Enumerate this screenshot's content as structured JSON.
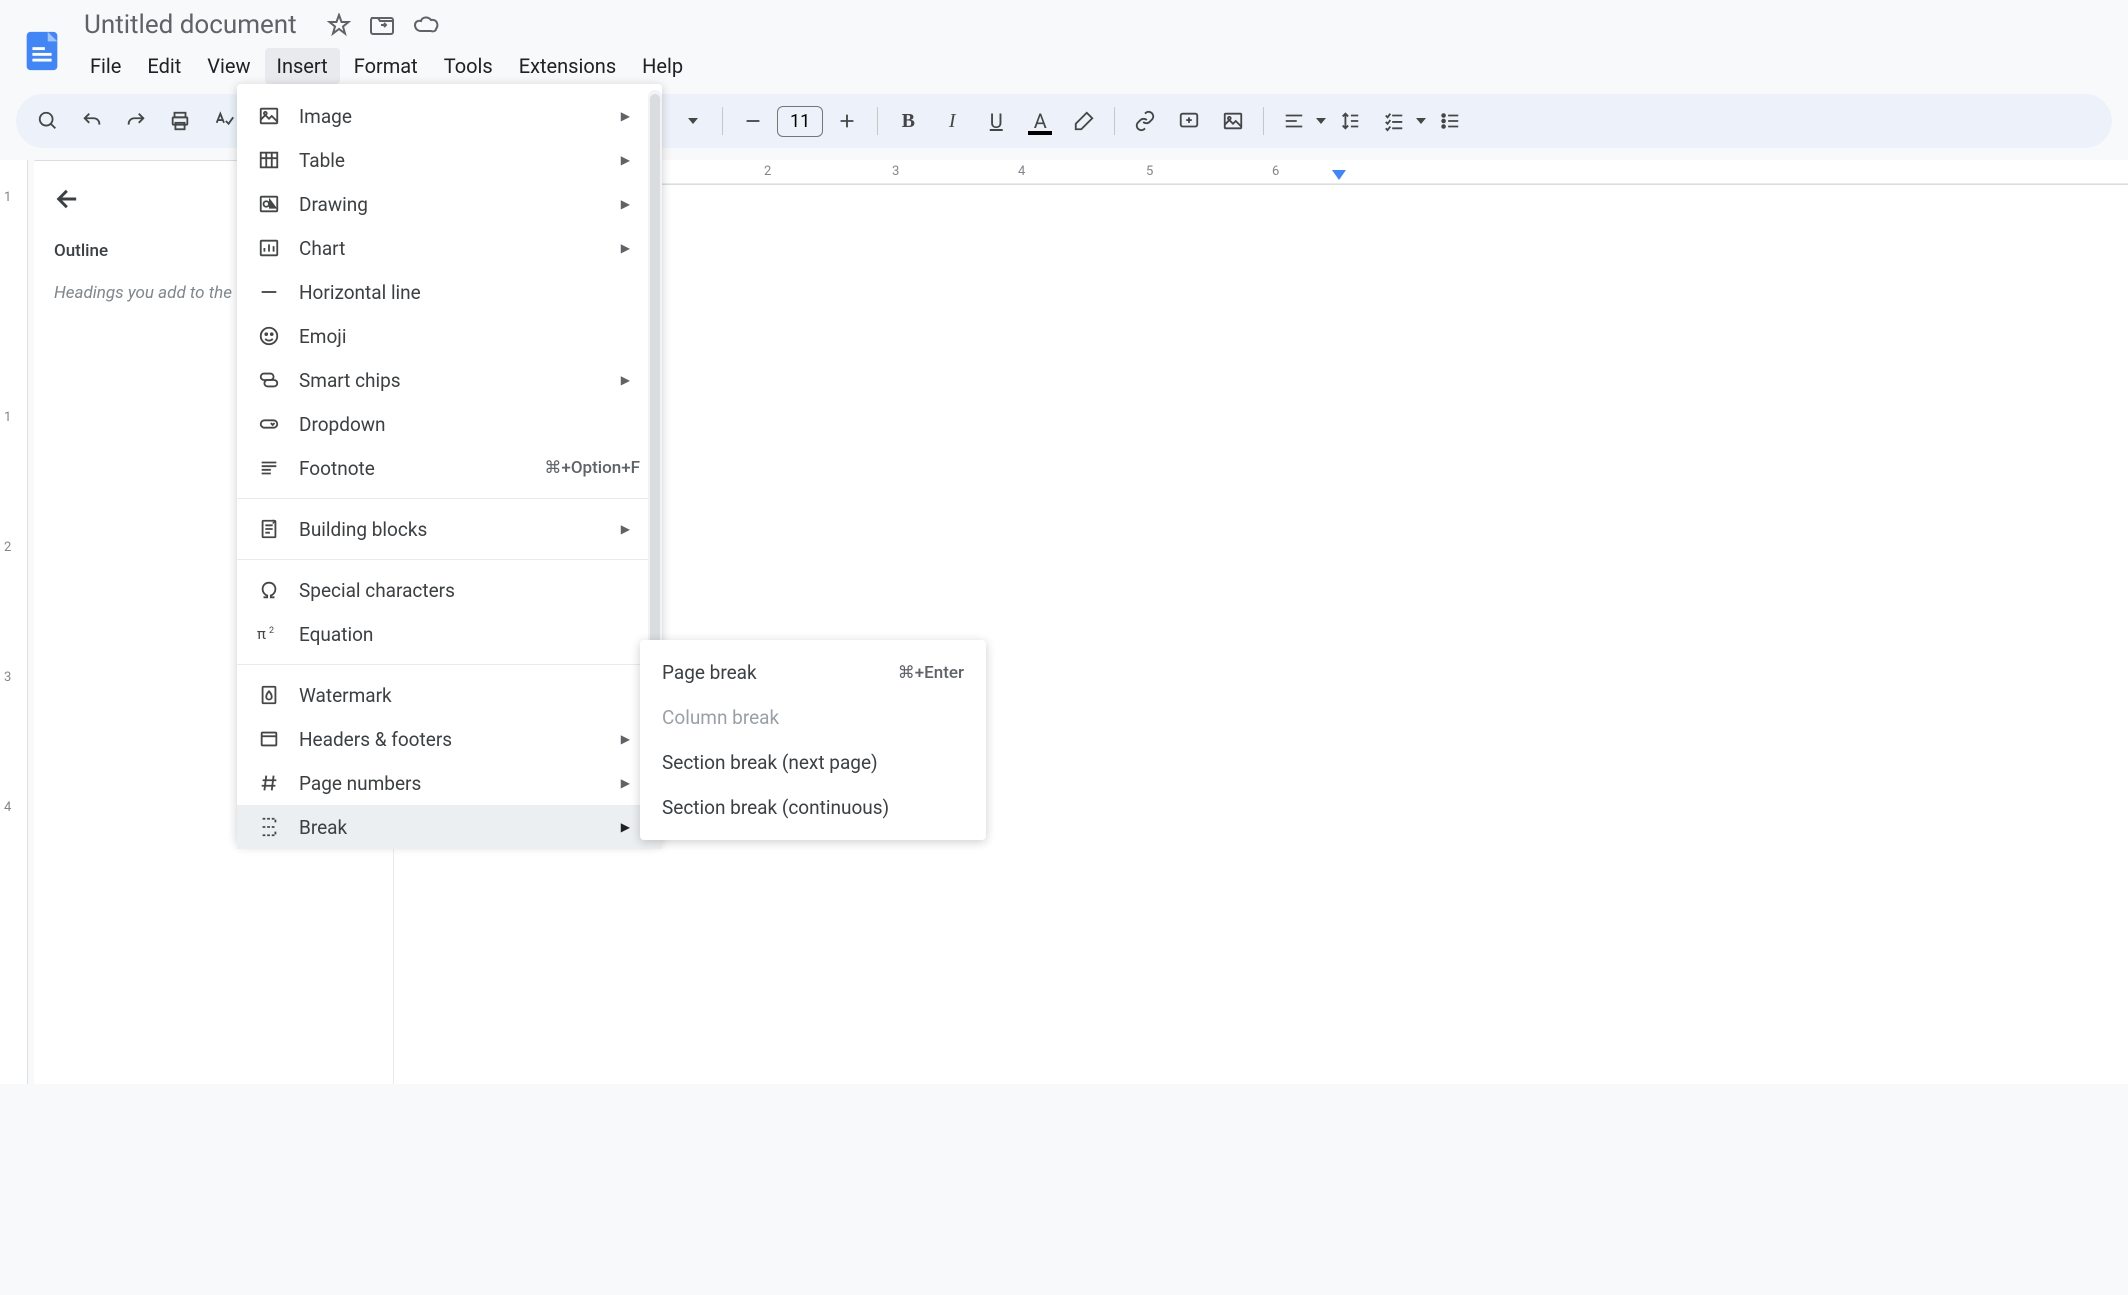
{
  "doc": {
    "title": "Untitled document"
  },
  "menubar": [
    "File",
    "Edit",
    "View",
    "Insert",
    "Format",
    "Tools",
    "Extensions",
    "Help"
  ],
  "active_menu_index": 3,
  "toolbar": {
    "font_size": "11"
  },
  "outline": {
    "title": "Outline",
    "hint": "Headings you add to the \nappear here."
  },
  "insert_menu": [
    {
      "icon": "image",
      "label": "Image",
      "submenu": true
    },
    {
      "icon": "table",
      "label": "Table",
      "submenu": true
    },
    {
      "icon": "drawing",
      "label": "Drawing",
      "submenu": true
    },
    {
      "icon": "chart",
      "label": "Chart",
      "submenu": true
    },
    {
      "icon": "hr",
      "label": "Horizontal line"
    },
    {
      "icon": "emoji",
      "label": "Emoji"
    },
    {
      "icon": "chips",
      "label": "Smart chips",
      "submenu": true
    },
    {
      "icon": "dropdown",
      "label": "Dropdown"
    },
    {
      "icon": "footnote",
      "label": "Footnote",
      "shortcut": "⌘+Option+F"
    },
    {
      "divider": true
    },
    {
      "icon": "blocks",
      "label": "Building blocks",
      "submenu": true
    },
    {
      "divider": true
    },
    {
      "icon": "omega",
      "label": "Special characters"
    },
    {
      "icon": "equation",
      "label": "Equation"
    },
    {
      "divider": true
    },
    {
      "icon": "watermark",
      "label": "Watermark"
    },
    {
      "icon": "headers",
      "label": "Headers & footers",
      "submenu": true
    },
    {
      "icon": "hash",
      "label": "Page numbers",
      "submenu": true
    },
    {
      "icon": "break",
      "label": "Break",
      "submenu": true,
      "highlighted": true,
      "dark_arrow": true
    }
  ],
  "break_submenu": [
    {
      "label": "Page break",
      "shortcut": "⌘+Enter"
    },
    {
      "label": "Column break",
      "disabled": true
    },
    {
      "label": "Section break (next page)"
    },
    {
      "label": "Section break (continuous)"
    }
  ],
  "ruler_numbers": [
    2,
    3,
    4,
    5,
    6
  ]
}
